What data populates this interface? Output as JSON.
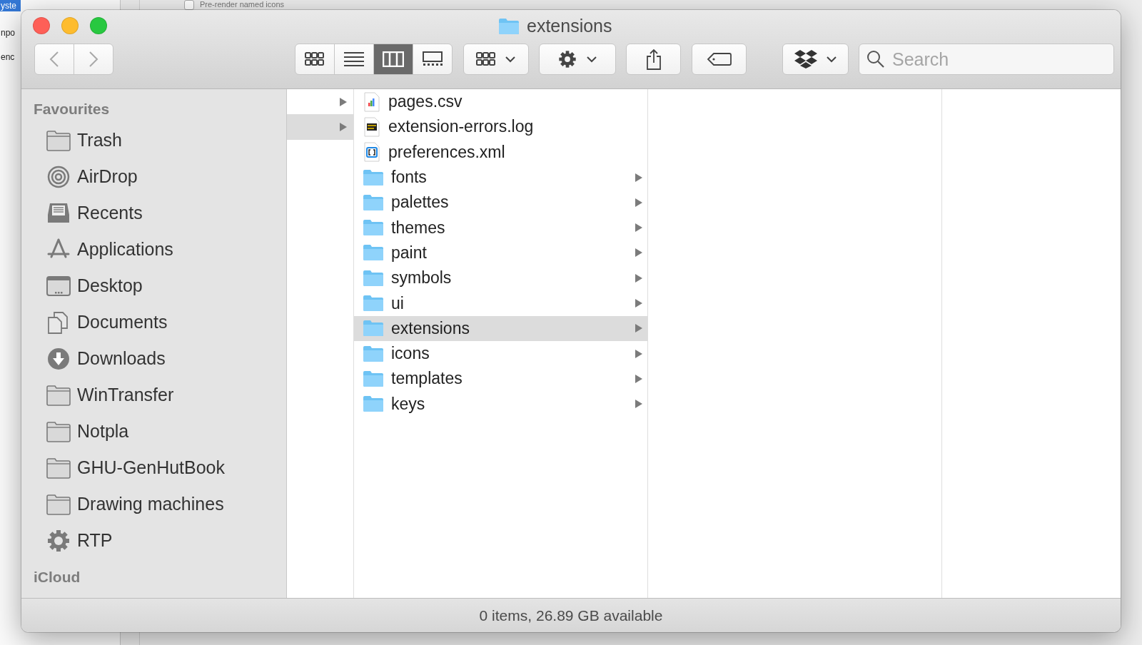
{
  "background": {
    "list_items": [
      {
        "label": "yste",
        "selected": true
      },
      {
        "label": "npo",
        "selected": false
      },
      {
        "label": "enc",
        "selected": false
      }
    ],
    "checkbox": {
      "label": "Pre-render named icons",
      "checked": false
    }
  },
  "window": {
    "title": "extensions"
  },
  "toolbar": {
    "view_modes": [
      {
        "kind": "icons",
        "selected": false
      },
      {
        "kind": "list",
        "selected": false
      },
      {
        "kind": "columns",
        "selected": true
      },
      {
        "kind": "gallery",
        "selected": false
      }
    ],
    "search": {
      "placeholder": "Search"
    }
  },
  "sidebar": {
    "sections": [
      {
        "heading": "Favourites",
        "items": [
          {
            "label": "Trash",
            "kind": "folder"
          },
          {
            "label": "AirDrop",
            "kind": "airdrop"
          },
          {
            "label": "Recents",
            "kind": "recents"
          },
          {
            "label": "Applications",
            "kind": "applications"
          },
          {
            "label": "Desktop",
            "kind": "desktop"
          },
          {
            "label": "Documents",
            "kind": "documents"
          },
          {
            "label": "Downloads",
            "kind": "downloads"
          },
          {
            "label": "WinTransfer",
            "kind": "folder"
          },
          {
            "label": "Notpla",
            "kind": "folder"
          },
          {
            "label": "GHU-GenHutBook",
            "kind": "folder"
          },
          {
            "label": "Drawing machines",
            "kind": "folder"
          },
          {
            "label": "RTP",
            "kind": "gear"
          }
        ]
      },
      {
        "heading": "iCloud"
      }
    ]
  },
  "columns": [
    {
      "rows": [
        {
          "selected": false
        },
        {
          "selected": true
        }
      ]
    },
    {
      "rows": [
        {
          "name": "pages.csv",
          "kind": "csv",
          "selected": false
        },
        {
          "name": "extension-errors.log",
          "kind": "log",
          "selected": false
        },
        {
          "name": "preferences.xml",
          "kind": "xml",
          "selected": false
        },
        {
          "name": "fonts",
          "kind": "folder",
          "selected": false
        },
        {
          "name": "palettes",
          "kind": "folder",
          "selected": false
        },
        {
          "name": "themes",
          "kind": "folder",
          "selected": false
        },
        {
          "name": "paint",
          "kind": "folder",
          "selected": false
        },
        {
          "name": "symbols",
          "kind": "folder",
          "selected": false
        },
        {
          "name": "ui",
          "kind": "folder",
          "selected": false
        },
        {
          "name": "extensions",
          "kind": "folder",
          "selected": true
        },
        {
          "name": "icons",
          "kind": "folder",
          "selected": false
        },
        {
          "name": "templates",
          "kind": "folder",
          "selected": false
        },
        {
          "name": "keys",
          "kind": "folder",
          "selected": false
        }
      ]
    },
    {},
    {}
  ],
  "status_bar": "0 items, 26.89 GB available"
}
